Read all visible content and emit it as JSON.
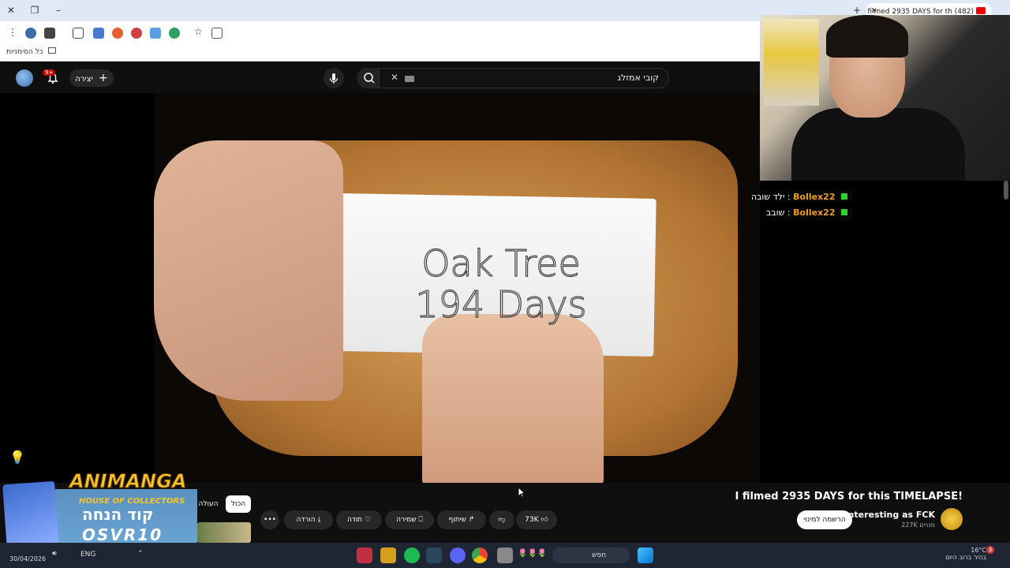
{
  "browser": {
    "tab_title": "(482) I filmed 2935 DAYS for th",
    "bookmarks_label": "כל הסימניות"
  },
  "youtube": {
    "search_query": "קובי אמזלג",
    "create_label": "יצירה",
    "notification_count": "9+"
  },
  "video": {
    "overlay_line1": "Oak Tree",
    "overlay_line2": "194 Days",
    "title": "I filmed 2935 DAYS for this TIMELAPSE!",
    "channel_name": "Interesting as FCK",
    "subscribers": "227K מנויים",
    "subscribe_label": "הרשמה למינוי",
    "like_count": "73K",
    "share_label": "שיתוף",
    "save_label": "שמירה",
    "thanks_label": "תודה",
    "download_label": "הורדה",
    "more_label": "•••"
  },
  "chips": {
    "all": "הכול",
    "upload": "העולה"
  },
  "chat": {
    "messages": [
      {
        "user": "Bollex22",
        "text": "ילד שובה"
      },
      {
        "user": "Bollex22",
        "text": "שובב"
      }
    ]
  },
  "sponsor": {
    "brand": "ANIMANGA",
    "subtitle": "HOUSE OF COLLECTORS",
    "code_label": "קוד הנחה",
    "code": "OSVR10"
  },
  "taskbar": {
    "search_label": "חפש",
    "language": "ENG",
    "date": "30/04/2026",
    "temperature": "16°C",
    "weather": "בהיר ברוב היום",
    "notifications": "3"
  }
}
